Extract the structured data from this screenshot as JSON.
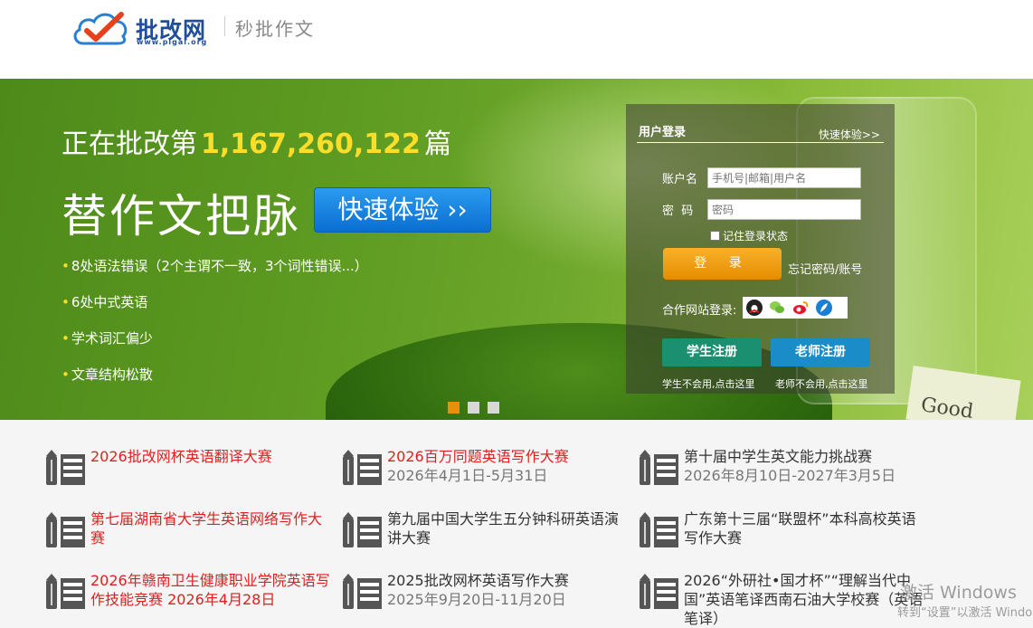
{
  "header": {
    "logo_name": "批改网",
    "logo_url": "www.pigai.org",
    "slogan": "秒批作文"
  },
  "banner": {
    "counter_prefix": "正在批改第",
    "counter_value": "1,167,260,122",
    "counter_suffix": "篇",
    "headline": "替作文把脉",
    "quick_button": "快速体验 ››",
    "features": [
      "8处语法错误（2个主谓不一致，3个词性错误...）",
      "6处中式英语",
      "学术词汇偏少",
      "文章结构松散"
    ],
    "background_card_text": "Good",
    "slides": {
      "count": 3,
      "active": 0
    },
    "colors": {
      "accent_yellow": "#ffde2a",
      "button_blue": "#0a6fd0",
      "indicator_active": "#e8900a",
      "indicator_inactive": "#d8d8d8"
    }
  },
  "login": {
    "title": "用户登录",
    "quick_link": "快速体验>>",
    "account_label": "账户名",
    "account_placeholder": "手机号|邮箱|用户名",
    "password_label": "密  码",
    "password_placeholder": "密码",
    "remember_label": "记住登录状态",
    "login_button": "登 录",
    "forgot_link": "忘记密码/账号",
    "partner_label": "合作网站登录:",
    "partner_icons": [
      "qq-icon",
      "wechat-icon",
      "weibo-icon",
      "feather-icon"
    ],
    "student_register": "学生注册",
    "teacher_register": "老师注册",
    "student_tip": "学生不会用,点击这里",
    "teacher_tip": "老师不会用,点击这里",
    "colors": {
      "login_orange": "#e68c00",
      "student_green": "#1a9070",
      "teacher_blue": "#1a8cc8"
    }
  },
  "competitions": [
    {
      "title": "2026批改网杯英语翻译大赛",
      "date": "",
      "highlight": true
    },
    {
      "title": "2026百万同题英语写作大赛",
      "date": "2026年4月1日-5月31日",
      "highlight": true
    },
    {
      "title": "第十届中学生英文能力挑战赛",
      "date": "2026年8月10日-2027年3月5日",
      "highlight": false
    },
    {
      "title": "第七届湖南省大学生英语网络写作大赛",
      "date": "",
      "highlight": true
    },
    {
      "title": "第九届中国大学生五分钟科研英语演讲大赛",
      "date": "",
      "highlight": false
    },
    {
      "title": "广东第十三届“联盟杯”本科高校英语写作大赛",
      "date": "",
      "highlight": false
    },
    {
      "title": "2026年赣南卫生健康职业学院英语写作技能竞赛 2026年4月28日",
      "date": "",
      "highlight": true
    },
    {
      "title": "2025批改网杯英语写作大赛",
      "date": "2025年9月20日-11月20日",
      "highlight": false
    },
    {
      "title": "2026“外研社•国才杯”“理解当代中国”英语笔译西南石油大学校赛（英语笔译）",
      "date": "",
      "highlight": false
    }
  ],
  "watermark": {
    "line1": "激活 Windows",
    "line2": "转到“设置”以激活 Windows。"
  }
}
